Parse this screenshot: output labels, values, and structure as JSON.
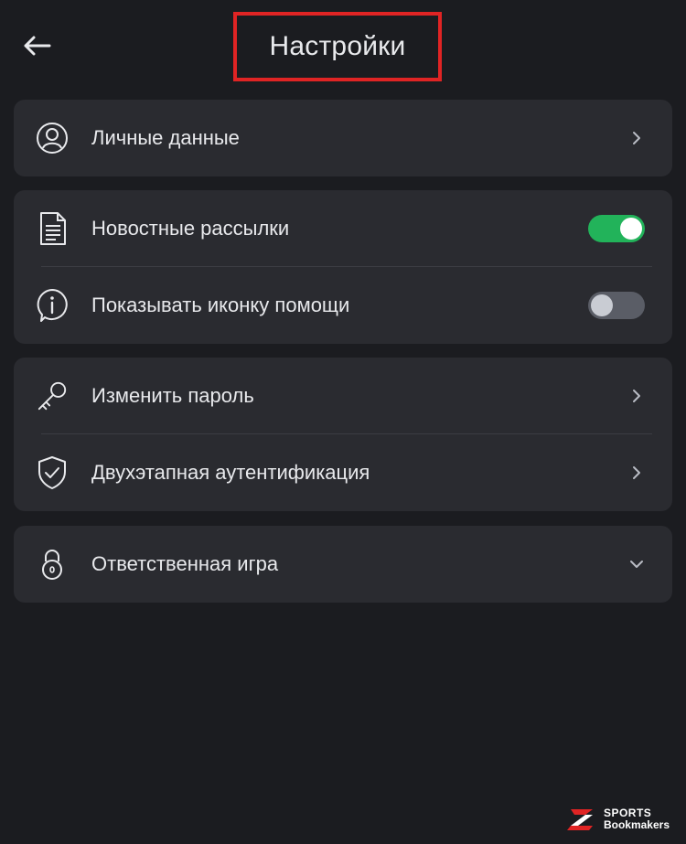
{
  "header": {
    "title": "Настройки"
  },
  "colors": {
    "background": "#1b1c20",
    "card": "#2a2b30",
    "toggle_on": "#22b35a",
    "toggle_off": "#5a5d66",
    "highlight_border": "#e02424"
  },
  "sections": {
    "personal": {
      "label": "Личные данные",
      "icon": "user-circle-icon"
    },
    "notifications": {
      "newsletters": {
        "label": "Новостные рассылки",
        "icon": "document-icon",
        "enabled": true
      },
      "help_icon": {
        "label": "Показывать иконку помощи",
        "icon": "info-bubble-icon",
        "enabled": false
      }
    },
    "security": {
      "change_password": {
        "label": "Изменить пароль",
        "icon": "key-icon"
      },
      "two_factor": {
        "label": "Двухэтапная аутентификация",
        "icon": "shield-check-icon"
      }
    },
    "responsible": {
      "label": "Ответственная игра",
      "icon": "lock-icon"
    }
  },
  "watermark": {
    "line1": "SPORTS",
    "line2": "Bookmakers"
  }
}
